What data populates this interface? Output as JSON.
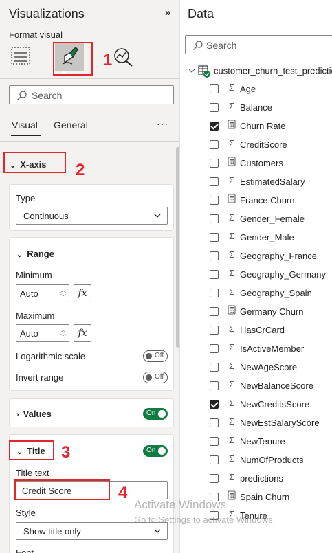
{
  "visualizations": {
    "title": "Visualizations",
    "collapse_glyph": "»",
    "format_visual_label": "Format visual",
    "icons": [
      "build-visual-icon",
      "format-visual-icon",
      "analytics-icon"
    ],
    "search_placeholder": "Search",
    "tabs": [
      {
        "label": "Visual",
        "active": true
      },
      {
        "label": "General",
        "active": false
      }
    ],
    "more_glyph": "···",
    "xaxis": {
      "header": "X-axis",
      "type_label": "Type",
      "type_value": "Continuous",
      "range": {
        "header": "Range",
        "minimum_label": "Minimum",
        "minimum_value": "Auto",
        "maximum_label": "Maximum",
        "maximum_value": "Auto",
        "fx": "fx",
        "log_label": "Logarithmic scale",
        "log_toggle": "Off",
        "invert_label": "Invert range",
        "invert_toggle": "Off"
      },
      "values": {
        "header": "Values",
        "toggle": "On"
      },
      "title": {
        "header": "Title",
        "toggle": "On",
        "title_text_label": "Title text",
        "title_text_value": "Credit Score",
        "style_label": "Style",
        "style_value": "Show title only",
        "font_label": "Font"
      }
    },
    "badges": [
      "1",
      "2",
      "3",
      "4"
    ]
  },
  "data_pane": {
    "title": "Data",
    "search_placeholder": "Search",
    "table_name": "customer_churn_test_predictions",
    "fields": [
      {
        "name": "Age",
        "icon": "sigma",
        "checked": false
      },
      {
        "name": "Balance",
        "icon": "sigma",
        "checked": false
      },
      {
        "name": "Churn Rate",
        "icon": "calculator",
        "checked": true
      },
      {
        "name": "CreditScore",
        "icon": "sigma",
        "checked": false
      },
      {
        "name": "Customers",
        "icon": "calculator",
        "checked": false
      },
      {
        "name": "EstimatedSalary",
        "icon": "sigma",
        "checked": false
      },
      {
        "name": "France Churn",
        "icon": "calculator",
        "checked": false
      },
      {
        "name": "Gender_Female",
        "icon": "sigma",
        "checked": false
      },
      {
        "name": "Gender_Male",
        "icon": "sigma",
        "checked": false
      },
      {
        "name": "Geography_France",
        "icon": "sigma",
        "checked": false
      },
      {
        "name": "Geography_Germany",
        "icon": "sigma",
        "checked": false
      },
      {
        "name": "Geography_Spain",
        "icon": "sigma",
        "checked": false
      },
      {
        "name": "Germany Churn",
        "icon": "calculator",
        "checked": false
      },
      {
        "name": "HasCrCard",
        "icon": "sigma",
        "checked": false
      },
      {
        "name": "IsActiveMember",
        "icon": "sigma",
        "checked": false
      },
      {
        "name": "NewAgeScore",
        "icon": "sigma",
        "checked": false
      },
      {
        "name": "NewBalanceScore",
        "icon": "sigma",
        "checked": false
      },
      {
        "name": "NewCreditsScore",
        "icon": "sigma",
        "checked": true
      },
      {
        "name": "NewEstSalaryScore",
        "icon": "sigma",
        "checked": false
      },
      {
        "name": "NewTenure",
        "icon": "sigma",
        "checked": false
      },
      {
        "name": "NumOfProducts",
        "icon": "sigma",
        "checked": false
      },
      {
        "name": "predictions",
        "icon": "sigma",
        "checked": false
      },
      {
        "name": "Spain Churn",
        "icon": "calculator",
        "checked": false
      },
      {
        "name": "Tenure",
        "icon": "sigma",
        "checked": false
      }
    ]
  },
  "watermark": {
    "line1": "Activate Windows",
    "line2": "Go to Settings to activate Windows."
  },
  "colors": {
    "accent_red": "#e3262b",
    "toggle_on": "#107c41",
    "table_check": "#107c41"
  }
}
